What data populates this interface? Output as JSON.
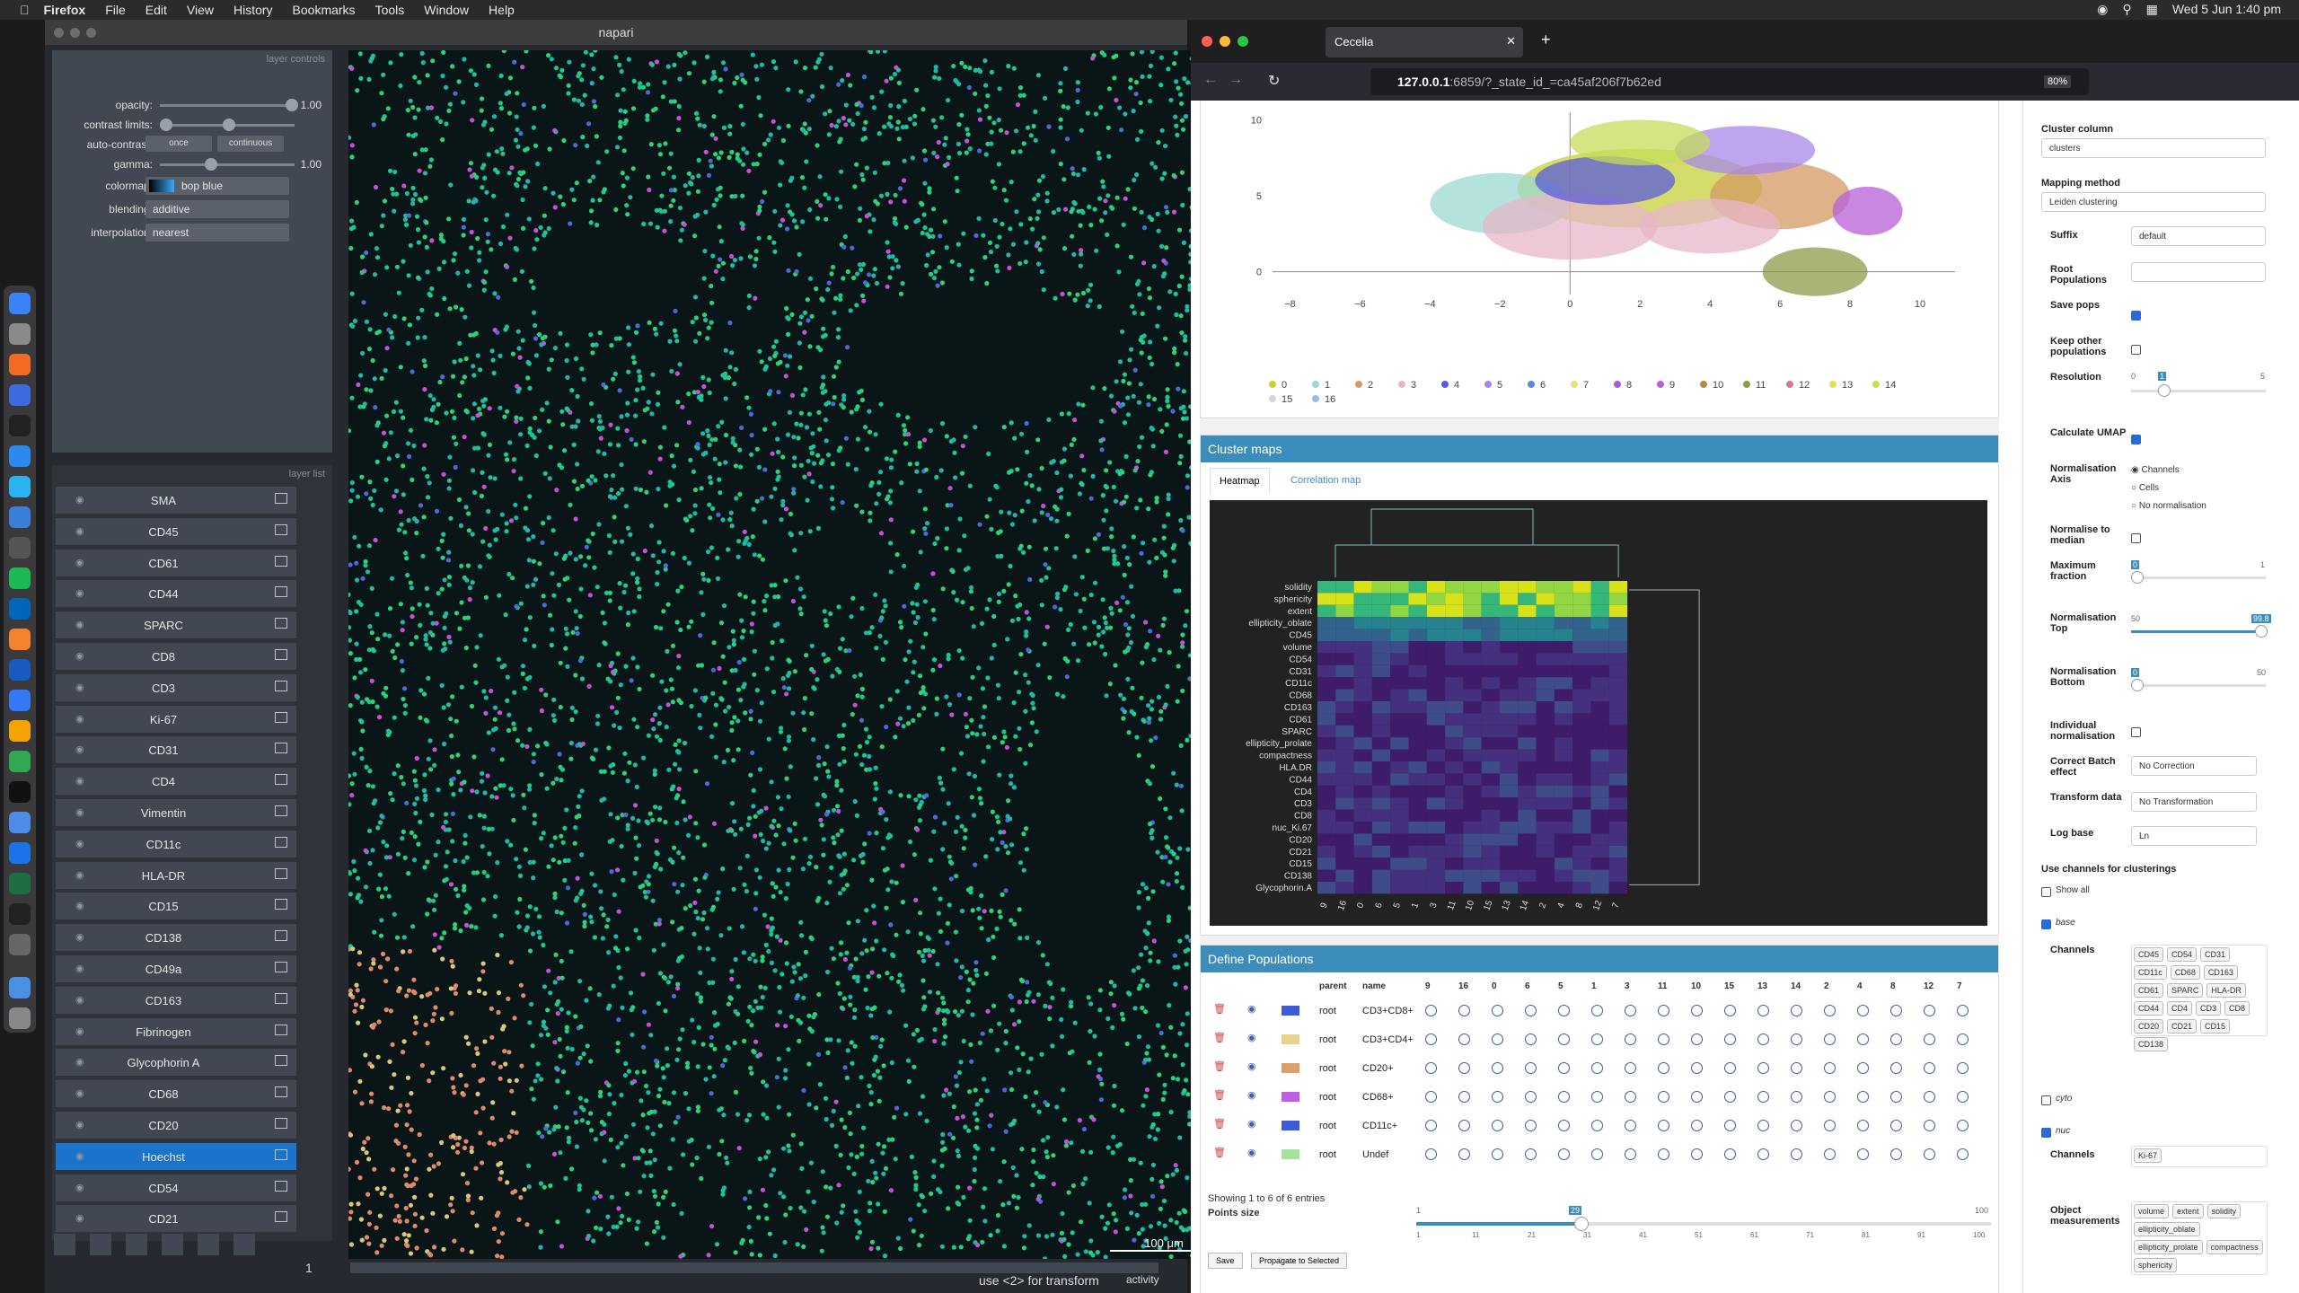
{
  "menubar": {
    "app": "Firefox",
    "items": [
      "File",
      "Edit",
      "View",
      "History",
      "Bookmarks",
      "Tools",
      "Window",
      "Help"
    ],
    "datetime": "Wed 5 Jun  1:40 pm"
  },
  "napari": {
    "title": "napari",
    "controls_header": "layer controls",
    "list_header": "layer list",
    "opacity_label": "opacity:",
    "opacity_value": "1.00",
    "contrast_label": "contrast limits:",
    "autocontrast_label": "auto-contrast:",
    "once": "once",
    "continuous": "continuous",
    "gamma_label": "gamma:",
    "gamma_value": "1.00",
    "colormap_label": "colormap:",
    "colormap_value": "bop blue",
    "blending_label": "blending:",
    "blending_value": "additive",
    "interp_label": "interpolation:",
    "interp_value": "nearest",
    "layers": [
      "SMA",
      "CD45",
      "CD61",
      "CD44",
      "SPARC",
      "CD8",
      "CD3",
      "Ki-67",
      "CD31",
      "CD4",
      "Vimentin",
      "CD11c",
      "HLA-DR",
      "CD15",
      "CD138",
      "CD49a",
      "CD163",
      "Fibrinogen",
      "Glycophorin A",
      "CD68",
      "CD20",
      "Hoechst",
      "CD54",
      "CD21"
    ],
    "selected_layer": "Hoechst",
    "scale_bar": "100 μm",
    "status": "use <2> for transform",
    "activity": "activity",
    "slider_index": "1"
  },
  "firefox": {
    "tab_title": "Cecelia",
    "url_host": "127.0.0.1",
    "url_rest": ":6859/?_state_id_=ca45af206f7b62ed",
    "zoom": "80%"
  },
  "umap": {
    "y_ticks": [
      "10",
      "5",
      "0"
    ],
    "x_ticks": [
      "−8",
      "−6",
      "−4",
      "−2",
      "0",
      "2",
      "4",
      "6",
      "8",
      "10"
    ],
    "legend": [
      "0",
      "1",
      "2",
      "3",
      "4",
      "5",
      "6",
      "7",
      "8",
      "9",
      "10",
      "11",
      "12",
      "13",
      "14",
      "15",
      "16"
    ],
    "legend_colors": [
      "#c6d23a",
      "#9bd8d0",
      "#d49a63",
      "#e7b6c9",
      "#5b5bd8",
      "#a788e8",
      "#5a8ad8",
      "#e8e07a",
      "#a15fd8",
      "#b85fd8",
      "#b88a45",
      "#8f9a48",
      "#d07a9a",
      "#e2de57",
      "#c6dc5a",
      "#d5d5d5",
      "#9ab8e8"
    ]
  },
  "cluster_maps": {
    "title": "Cluster maps",
    "tabs": [
      "Heatmap",
      "Correlation map"
    ],
    "row_labels": [
      "solidity",
      "sphericity",
      "extent",
      "ellipticity_oblate",
      "CD45",
      "volume",
      "CD54",
      "CD31",
      "CD11c",
      "CD68",
      "CD163",
      "CD61",
      "SPARC",
      "ellipticity_prolate",
      "compactness",
      "HLA.DR",
      "CD44",
      "CD4",
      "CD3",
      "CD8",
      "nuc_Ki.67",
      "CD20",
      "CD21",
      "CD15",
      "CD138",
      "Glycophorin.A"
    ],
    "col_labels": [
      "9",
      "16",
      "0",
      "6",
      "5",
      "1",
      "3",
      "11",
      "10",
      "15",
      "13",
      "14",
      "2",
      "4",
      "8",
      "12",
      "7"
    ]
  },
  "populations": {
    "title": "Define Populations",
    "headers": [
      "parent",
      "name",
      "9",
      "16",
      "0",
      "6",
      "5",
      "1",
      "3",
      "11",
      "10",
      "15",
      "13",
      "14",
      "2",
      "4",
      "8",
      "12",
      "7"
    ],
    "rows": [
      {
        "parent": "root",
        "name": "CD3+CD8+",
        "color": "#3b5bd8"
      },
      {
        "parent": "root",
        "name": "CD3+CD4+",
        "color": "#e6d48a"
      },
      {
        "parent": "root",
        "name": "CD20+",
        "color": "#d8a06a"
      },
      {
        "parent": "root",
        "name": "CD68+",
        "color": "#c05de0"
      },
      {
        "parent": "root",
        "name": "CD11c+",
        "color": "#3b5bd8"
      },
      {
        "parent": "root",
        "name": "Undef",
        "color": "#a6e39a"
      }
    ],
    "showing": "Showing 1 to 6 of 6 entries",
    "points_size": "Points size",
    "points_value": "29",
    "points_min": "1",
    "points_max": "100",
    "points_ticks": [
      "1",
      "11",
      "21",
      "31",
      "41",
      "51",
      "61",
      "71",
      "81",
      "91",
      "100"
    ],
    "save": "Save",
    "propagate": "Propagate to Selected"
  },
  "settings": {
    "cluster_column_label": "Cluster column",
    "cluster_column_value": "clusters",
    "mapping_label": "Mapping method",
    "mapping_value": "Leiden clustering",
    "suffix_label": "Suffix",
    "suffix_value": "default",
    "root_pops_label": "Root Populations",
    "save_pops_label": "Save pops",
    "keep_other_label": "Keep other populations",
    "resolution_label": "Resolution",
    "resolution_min": "0",
    "resolution_value": "1",
    "resolution_max": "5",
    "calc_umap_label": "Calculate UMAP",
    "norm_axis_label": "Normalisation Axis",
    "norm_axis_options": [
      "Channels",
      "Cells",
      "No normalisation"
    ],
    "norm_median_label": "Normalise to median",
    "max_fraction_label": "Maximum fraction",
    "max_fraction_value": "0",
    "max_fraction_max": "1",
    "norm_top_label": "Normalisation Top",
    "norm_top_min": "50",
    "norm_top_value": "99.8",
    "norm_bottom_label": "Normalisation Bottom",
    "norm_bottom_value": "0",
    "norm_bottom_max": "50",
    "indiv_norm_label": "Individual normalisation",
    "batch_label": "Correct Batch effect",
    "batch_value": "No Correction",
    "transform_label": "Transform data",
    "transform_value": "No Transformation",
    "logbase_label": "Log base",
    "logbase_value": "Ln",
    "use_channels_label": "Use channels for clusterings",
    "show_all": "Show all",
    "base": "base",
    "channels_label": "Channels",
    "base_channels": [
      "CD45",
      "CD54",
      "CD31",
      "CD11c",
      "CD68",
      "CD163",
      "CD61",
      "SPARC",
      "HLA-DR",
      "CD44",
      "CD4",
      "CD3",
      "CD8",
      "CD20",
      "CD21",
      "CD15",
      "CD138"
    ],
    "cyto": "cyto",
    "nuc": "nuc",
    "nuc_channels": [
      "Ki-67"
    ],
    "object_meas_label": "Object measurements",
    "object_meas": [
      "volume",
      "extent",
      "solidity",
      "ellipticity_oblate",
      "ellipticity_prolate",
      "compactness",
      "sphericity"
    ]
  }
}
